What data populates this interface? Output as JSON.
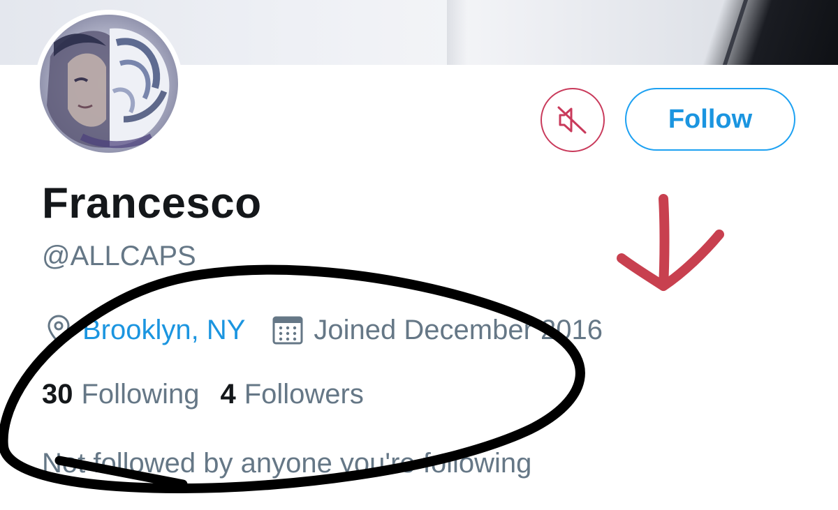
{
  "profile": {
    "display_name": "Francesco",
    "handle": "@ALLCAPS",
    "location": "Brooklyn, NY",
    "joined": "Joined December 2016",
    "following_count": "30",
    "following_label": "Following",
    "followers_count": "4",
    "followers_label": "Followers",
    "not_followed_text": "Not followed by anyone you're following"
  },
  "actions": {
    "follow_label": "Follow",
    "muted_icon": "speaker-muted-icon"
  },
  "icons": {
    "location": "location-pin-icon",
    "calendar": "calendar-icon"
  },
  "colors": {
    "accent_blue": "#1da1f2",
    "muted_red": "#c93a5b",
    "text_primary": "#14171a",
    "text_secondary": "#657786",
    "annotation_arrow": "#c8404f",
    "annotation_circle": "#000000"
  }
}
